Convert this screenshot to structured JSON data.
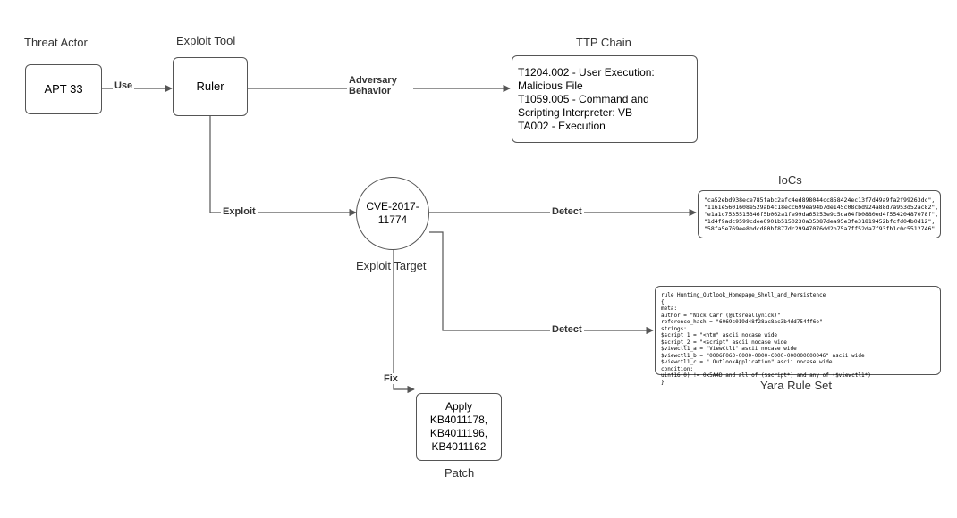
{
  "actor": {
    "label": "Threat Actor",
    "name": "APT 33"
  },
  "tool": {
    "label": "Exploit Tool",
    "name": "Ruler"
  },
  "ttp": {
    "label": "TTP Chain",
    "lines": "T1204.002 - User Execution: Malicious File\nT1059.005 - Command and Scripting Interpreter: VB\nTA002 - Execution"
  },
  "target": {
    "label": "Exploit Target",
    "name": "CVE-2017-11774"
  },
  "patch": {
    "label": "Patch",
    "name": "Apply KB4011178, KB4011196, KB4011162"
  },
  "iocs": {
    "label": "IoCs",
    "lines": "\"ca52ebd938ece785fabc2afc4ed898044cc858424ec13f7d49a9fa2f99263dc\",\n\"1161e5601608e529ab4c18ecc699ea94b7de145c08cbd924a88d7a953d52ac82\",\n\"e1a1c7535515346f5b062a1fe99da65253e9c5da04fb0880ed4f55420487078f\",\n\"1d4f9adc9599cdee0901b5150230a35387dea95e3fe31819452bfcfd04b0d12\",\n\"58fa5e769ee8bdcd80bf877dc29947076dd2b75a7ff52da7f93fb1c0c5512746\""
  },
  "yara": {
    "label": "Yara Rule Set",
    "rule": "rule Hunting_Outlook_Homepage_Shell_and_Persistence\n{\nmeta:\nauthor = \"Nick Carr (@itsreallynick)\"\nreference_hash = \"6069c019d48f28ac8ac3b4dd754ff6e\"\nstrings:\n$script_1 = \"<htm\" ascii nocase wide\n$script_2 = \"<script\" ascii nocase wide\n$viewctl1_a = \"ViewCtl1\" ascii nocase wide\n$viewctl1_b = \"0006F063-0000-0000-C000-000000000046\" ascii wide\n$viewctl1_c = \".OutlookApplication\" ascii nocase wide\ncondition:\nuint16(0) != 0x5A4D and all of ($script*) and any of ($viewctl1*)\n}"
  },
  "edges": {
    "use": "Use",
    "adv": "Adversary Behavior",
    "exploit": "Exploit",
    "detect": "Detect",
    "fix": "Fix"
  }
}
